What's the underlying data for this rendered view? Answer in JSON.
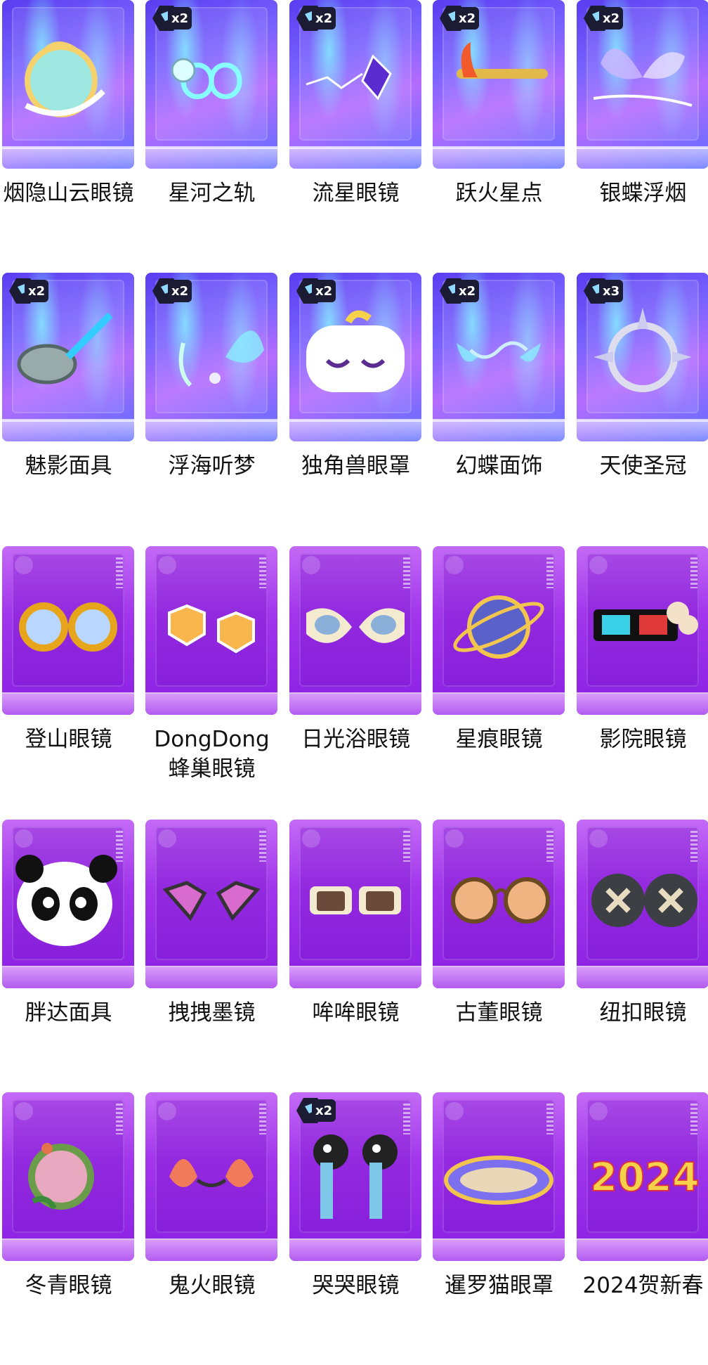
{
  "rows": [
    [
      {
        "name": "烟隐山云眼镜",
        "badge": "",
        "style": "holo",
        "icon": "cloud-moon-glasses-icon"
      },
      {
        "name": "星河之轨",
        "badge": "x2",
        "style": "holo",
        "icon": "infinity-glasses-icon"
      },
      {
        "name": "流星眼镜",
        "badge": "x2",
        "style": "holo",
        "icon": "meteor-glasses-icon"
      },
      {
        "name": "跃火星点",
        "badge": "x2",
        "style": "holo",
        "icon": "flame-glasses-icon"
      },
      {
        "name": "银蝶浮烟",
        "badge": "x2",
        "style": "holo",
        "icon": "butterfly-glasses-icon"
      }
    ],
    [
      {
        "name": "魅影面具",
        "badge": "x2",
        "style": "holo",
        "icon": "phantom-mask-icon"
      },
      {
        "name": "浮海听梦",
        "badge": "x2",
        "style": "holo",
        "icon": "sea-butterfly-glasses-icon"
      },
      {
        "name": "独角兽眼罩",
        "badge": "x2",
        "style": "holo",
        "icon": "unicorn-eye-mask-icon"
      },
      {
        "name": "幻蝶面饰",
        "badge": "x2",
        "style": "holo",
        "icon": "butterfly-face-ornament-icon"
      },
      {
        "name": "天使圣冠",
        "badge": "x3",
        "style": "holo",
        "icon": "angel-crown-icon"
      }
    ],
    [
      {
        "name": "登山眼镜",
        "badge": "",
        "style": "purple",
        "icon": "hiking-glasses-icon"
      },
      {
        "name": "DongDong蜂巢眼镜",
        "badge": "",
        "style": "purple",
        "icon": "honeycomb-glasses-icon"
      },
      {
        "name": "日光浴眼镜",
        "badge": "",
        "style": "purple",
        "icon": "sunbathing-glasses-icon"
      },
      {
        "name": "星痕眼镜",
        "badge": "",
        "style": "purple",
        "icon": "planet-monocle-icon"
      },
      {
        "name": "影院眼镜",
        "badge": "",
        "style": "purple",
        "icon": "3d-cinema-glasses-icon"
      }
    ],
    [
      {
        "name": "胖达面具",
        "badge": "",
        "style": "purple",
        "icon": "panda-mask-icon"
      },
      {
        "name": "拽拽墨镜",
        "badge": "",
        "style": "purple",
        "icon": "heart-sunglasses-icon"
      },
      {
        "name": "哞哞眼镜",
        "badge": "",
        "style": "purple",
        "icon": "cow-glasses-icon"
      },
      {
        "name": "古董眼镜",
        "badge": "",
        "style": "purple",
        "icon": "antique-glasses-icon"
      },
      {
        "name": "纽扣眼镜",
        "badge": "",
        "style": "purple",
        "icon": "button-glasses-icon"
      }
    ],
    [
      {
        "name": "冬青眼镜",
        "badge": "",
        "style": "purple",
        "icon": "holly-monocle-icon"
      },
      {
        "name": "鬼火眼镜",
        "badge": "",
        "style": "purple",
        "icon": "will-o-wisp-glasses-icon"
      },
      {
        "name": "哭哭眼镜",
        "badge": "x2",
        "style": "purple",
        "icon": "crying-glasses-icon"
      },
      {
        "name": "暹罗猫眼罩",
        "badge": "",
        "style": "purple",
        "icon": "siamese-cat-eye-mask-icon"
      },
      {
        "name": "2024贺新春",
        "badge": "",
        "style": "purple",
        "icon": "2024-new-year-glasses-icon"
      }
    ]
  ]
}
